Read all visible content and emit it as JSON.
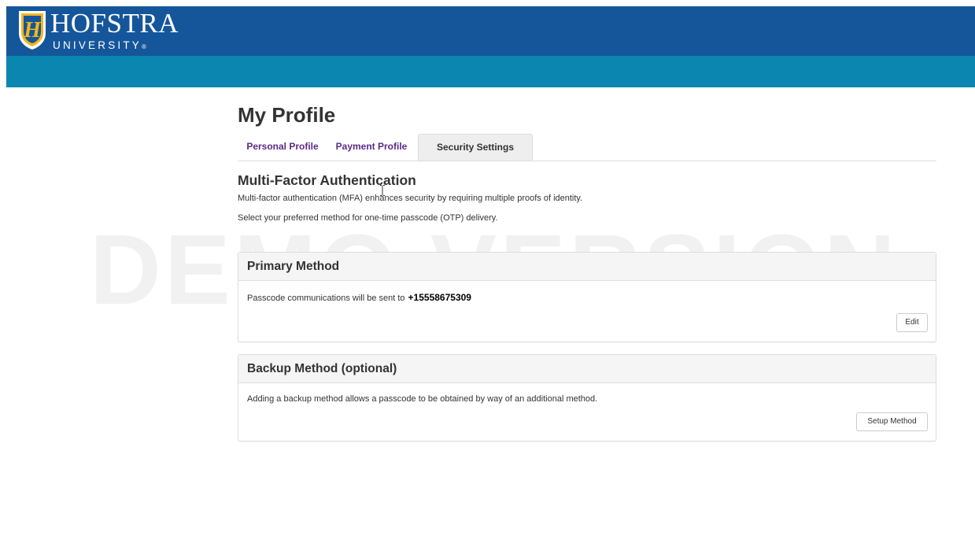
{
  "brand": {
    "name": "HOFSTRA",
    "subtitle": "UNIVERSITY",
    "shield_letter": "H",
    "primary_color": "#15569b",
    "band_color": "#0a86b0",
    "gold_color": "#f3b71b"
  },
  "watermark": "DEMO VERSION",
  "page": {
    "title": "My Profile"
  },
  "tabs": [
    {
      "label": "Personal Profile",
      "active": false
    },
    {
      "label": "Payment Profile",
      "active": false
    },
    {
      "label": "Security Settings",
      "active": true
    }
  ],
  "mfa": {
    "title": "Multi-Factor Authentication",
    "description": "Multi-factor authentication (MFA) enhances security by requiring multiple proofs of identity.",
    "instruction": "Select your preferred method for one-time passcode (OTP) delivery."
  },
  "primary_method": {
    "heading": "Primary Method",
    "text": "Passcode communications will be sent to",
    "phone": "+15558675309",
    "button_label": "Edit"
  },
  "backup_method": {
    "heading": "Backup Method (optional)",
    "text": "Adding a backup method allows a passcode to be obtained by way of an additional method.",
    "button_label": "Setup Method"
  },
  "icons": {
    "logo": "hofstra-shield-icon",
    "cursor": "text-cursor-icon"
  }
}
